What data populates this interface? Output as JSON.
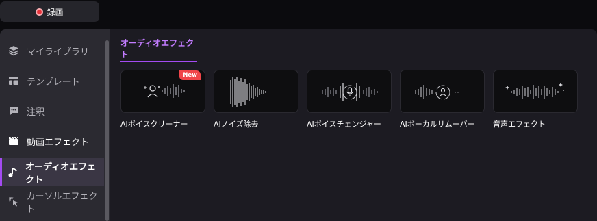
{
  "toolbar": {
    "record_label": "録画",
    "record_color": "#e8343c"
  },
  "sidebar": {
    "items": [
      {
        "label": "マイライブラリ",
        "icon": "layers-icon"
      },
      {
        "label": "テンプレート",
        "icon": "template-icon"
      },
      {
        "label": "注釈",
        "icon": "comment-icon"
      },
      {
        "label": "動画エフェクト",
        "icon": "clapperboard-icon"
      },
      {
        "label": "オーディオエフェクト",
        "icon": "music-note-icon",
        "active": true
      },
      {
        "label": "カーソルエフェクト",
        "icon": "cursor-click-icon"
      }
    ]
  },
  "main": {
    "tabs": [
      {
        "label": "オーディオエフェクト",
        "active": true
      }
    ],
    "accent_color": "#a44bf2",
    "cards": [
      {
        "label": "AIボイスクリーナー",
        "badge": "New",
        "icon": "person-waveform-icon"
      },
      {
        "label": "AIノイズ除去",
        "icon": "waveform-icon"
      },
      {
        "label": "AIボイスチェンジャー",
        "icon": "microphone-waveform-icon"
      },
      {
        "label": "AIボーカルリムーバー",
        "icon": "person-remove-waveform-icon"
      },
      {
        "label": "音声エフェクト",
        "icon": "sparkle-waveform-icon"
      }
    ]
  }
}
